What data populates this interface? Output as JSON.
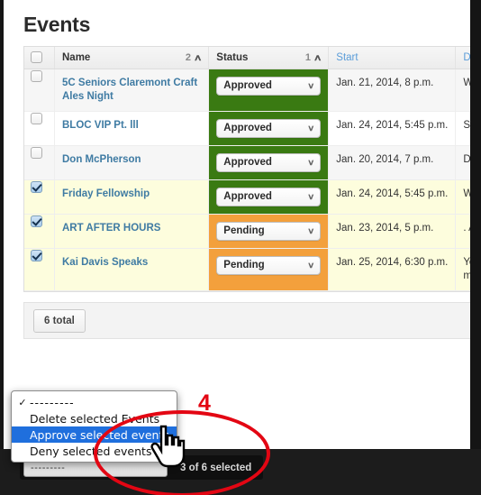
{
  "page": {
    "title": "Events"
  },
  "table": {
    "columns": [
      {
        "label": "",
        "kind": "checkbox"
      },
      {
        "label": "Name",
        "sort_order": "2",
        "sort_dir": "asc",
        "kind": "sortable"
      },
      {
        "label": "Status",
        "sort_order": "1",
        "sort_dir": "asc",
        "kind": "sortable"
      },
      {
        "label": "Start",
        "kind": "link"
      },
      {
        "label": "Description",
        "kind": "link"
      }
    ],
    "select_all_checked": false,
    "rows": [
      {
        "selected": false,
        "name": "5C Seniors Claremont Craft Ales Night",
        "status": "Approved",
        "status_color": "#3a7a12",
        "start": "Jan. 21, 2014, 8 p.m.",
        "description": "Welcome back"
      },
      {
        "selected": false,
        "name": "BLOC VIP Pt. lll",
        "status": "Approved",
        "status_color": "#3a7a12",
        "start": "Jan. 24, 2014, 5:45 p.m.",
        "description": "Stay BLOC"
      },
      {
        "selected": false,
        "name": "Don McPherson",
        "status": "Approved",
        "status_color": "#3a7a12",
        "start": "Jan. 20, 2014, 7 p.m.",
        "description": "Don McPherso"
      },
      {
        "selected": true,
        "name": "Friday Fellowship",
        "status": "Approved",
        "status_color": "#3a7a12",
        "start": "Jan. 24, 2014, 5:45 p.m.",
        "description": "Weekly Friday"
      },
      {
        "selected": true,
        "name": "ART AFTER HOURS",
        "status": "Pending",
        "status_color": "#f3a03c",
        "start": "Jan. 23, 2014, 5 p.m.",
        "description": ". Art After Hou conjunction wi"
      },
      {
        "selected": true,
        "name": "Kai Davis Speaks",
        "status": "Pending",
        "status_color": "#f3a03c",
        "start": "Jan. 25, 2014, 6:30 p.m.",
        "description": "Youth Poetry S and gender. S means of expr"
      }
    ]
  },
  "paginator": {
    "total_label": "6 total"
  },
  "action_bar": {
    "select_value": "---------",
    "selected_count_label": "3 of 6 selected"
  },
  "dropdown": {
    "items": [
      {
        "label": "---------",
        "checked": true,
        "highlighted": false
      },
      {
        "label": "Delete selected Events",
        "checked": false,
        "highlighted": false
      },
      {
        "label": "Approve selected events",
        "checked": false,
        "highlighted": true
      },
      {
        "label": "Deny selected events",
        "checked": false,
        "highlighted": false
      }
    ]
  },
  "annotation": {
    "step_number": "4",
    "color": "#e30613"
  },
  "icons": {
    "sort_caret": "∧",
    "select_caret": "∨",
    "dropdown_check": "✓"
  }
}
